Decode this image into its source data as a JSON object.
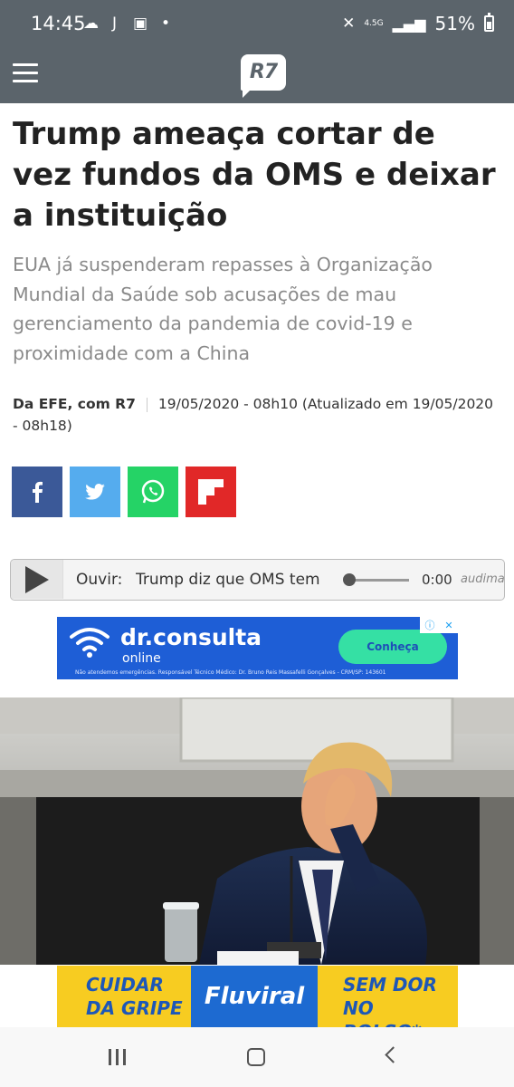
{
  "status_bar": {
    "time": "14:45",
    "battery": "51%",
    "network": "4.5G"
  },
  "header": {
    "logo": "R7"
  },
  "article": {
    "title": "Trump ameaça cortar de vez fundos da OMS e deixar a instituição",
    "subtitle": "EUA já suspenderam repasses à Organização Mundial da Saúde sob acusações de mau gerenciamento da pandemia de covid-19 e proximidade com a China",
    "author": "Da EFE, com R7",
    "date": "19/05/2020 - 08h10 (Atualizado em 19/05/2020 - 08h18)"
  },
  "share": {
    "facebook": "f",
    "twitter": "t",
    "whatsapp": "w",
    "flipboard": "f"
  },
  "player": {
    "label": "Ouvir:",
    "track": "Trump diz que OMS tem",
    "time": "0:00",
    "brand": "audima",
    "progress": 0
  },
  "ad_top": {
    "brand": "dr.consulta",
    "tagline": "online",
    "cta": "Conheça",
    "fine_print": "Não atendemos emergências. Responsável Técnico Médico: Dr. Bruno Reis Massafelli Gonçalves - CRM/SP: 143601"
  },
  "ad_bottom": {
    "left_text": "CUIDAR DA GRIPE",
    "brand": "Fluviral",
    "right_text": "SEM DOR NO BOLSO*"
  },
  "colors": {
    "header_bg": "#5b646b",
    "facebook": "#3b5998",
    "twitter": "#55acee",
    "whatsapp": "#25d366",
    "flipboard": "#e12828"
  }
}
